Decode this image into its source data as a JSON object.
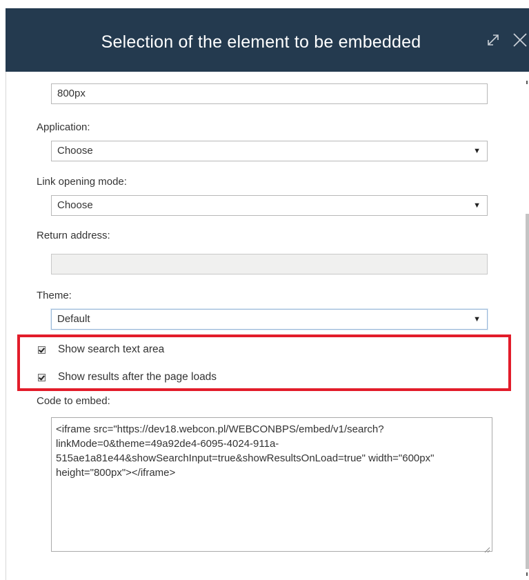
{
  "dialog": {
    "title": "Selection of the element to be embedded",
    "expand_icon": "expand-icon",
    "close_icon": "close-icon"
  },
  "fields": {
    "height": {
      "value": "800px"
    },
    "application": {
      "label": "Application:",
      "value": "Choose"
    },
    "link_opening_mode": {
      "label": "Link opening mode:",
      "value": "Choose"
    },
    "return_address": {
      "label": "Return address:",
      "value": ""
    },
    "theme": {
      "label": "Theme:",
      "value": "Default"
    }
  },
  "options": {
    "show_search_text_area": {
      "label": "Show search text area",
      "checked": true
    },
    "show_results_after_load": {
      "label": "Show results after the page loads",
      "checked": true
    }
  },
  "embed": {
    "label": "Code to embed:",
    "code": "<iframe src=\"https://dev18.webcon.pl/WEBCONBPS/embed/v1/search?linkMode=0&theme=49a92de4-6095-4024-911a-515ae1a81e44&showSearchInput=true&showResultsOnLoad=true\" width=\"600px\" height=\"800px\"></iframe>"
  },
  "colors": {
    "header_bg": "#243a4f",
    "highlight": "#e21c2a"
  }
}
